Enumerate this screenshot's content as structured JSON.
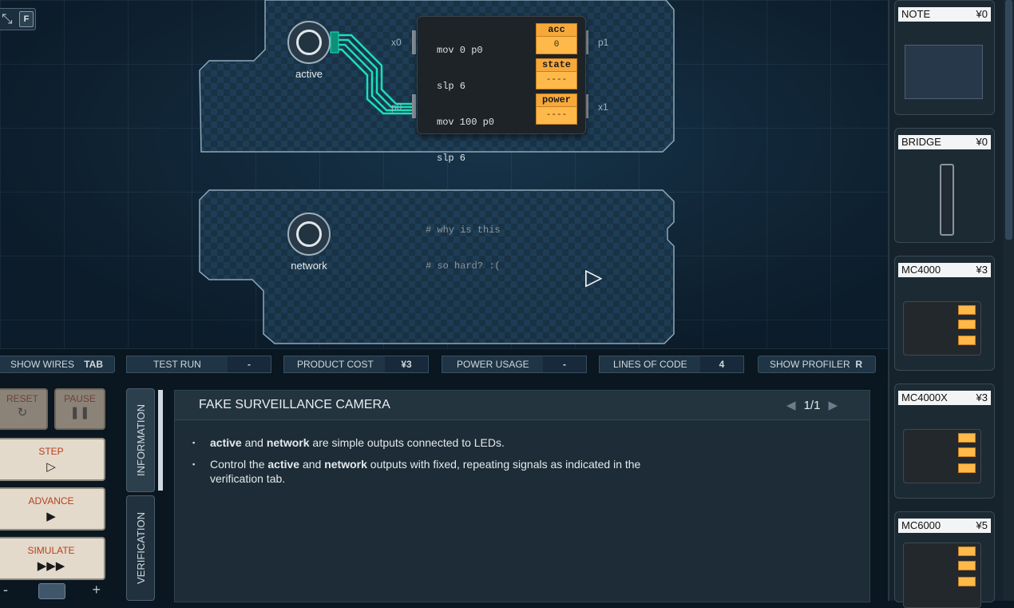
{
  "fullscreen": {
    "key": "F",
    "icon": "expand-icon"
  },
  "ports": {
    "active": "active",
    "network": "network"
  },
  "chip": {
    "code": [
      "mov 0 p0",
      "slp 6",
      "mov 100 p0",
      "slp 6",
      "",
      "# why is this",
      "# so hard? :("
    ],
    "registers": [
      {
        "name": "acc",
        "value": "0"
      },
      {
        "name": "state",
        "value": "----"
      },
      {
        "name": "power",
        "value": "----"
      }
    ],
    "pins": {
      "x0": "x0",
      "p0": "p0",
      "p1": "p1",
      "x1": "x1"
    }
  },
  "statusbar": {
    "show_wires": "SHOW WIRES",
    "show_wires_key": "TAB",
    "test_run": "TEST RUN",
    "test_run_value": "-",
    "product_cost": "PRODUCT COST",
    "product_cost_value": "¥3",
    "power_usage": "POWER USAGE",
    "power_usage_value": "-",
    "lines_of_code": "LINES OF CODE",
    "lines_of_code_value": "4",
    "show_profiler": "SHOW PROFILER",
    "show_profiler_key": "R"
  },
  "controls": {
    "reset": "RESET",
    "pause": "PAUSE",
    "step": "STEP",
    "advance": "ADVANCE",
    "simulate": "SIMULATE",
    "minus": "-",
    "plus": "+"
  },
  "tabs": {
    "information": "INFORMATION",
    "verification": "VERIFICATION"
  },
  "info": {
    "title": "FAKE SURVEILLANCE CAMERA",
    "page": "1/1",
    "bullet1": {
      "b1": "active",
      "t1": " and ",
      "b2": "network",
      "t2": " are simple outputs connected to LEDs."
    },
    "bullet2": {
      "t0": "Control the ",
      "b1": "active",
      "t1": " and ",
      "b2": "network",
      "t2": " outputs with fixed, repeating signals as indicated in the verification tab."
    }
  },
  "parts": [
    {
      "name": "NOTE",
      "price": "¥0"
    },
    {
      "name": "BRIDGE",
      "price": "¥0"
    },
    {
      "name": "MC4000",
      "price": "¥3"
    },
    {
      "name": "MC4000X",
      "price": "¥3"
    },
    {
      "name": "MC6000",
      "price": "¥5"
    }
  ],
  "colors": {
    "wire": "#19e0b8",
    "register": "#ffb94a",
    "accent_red": "#b7401f"
  }
}
